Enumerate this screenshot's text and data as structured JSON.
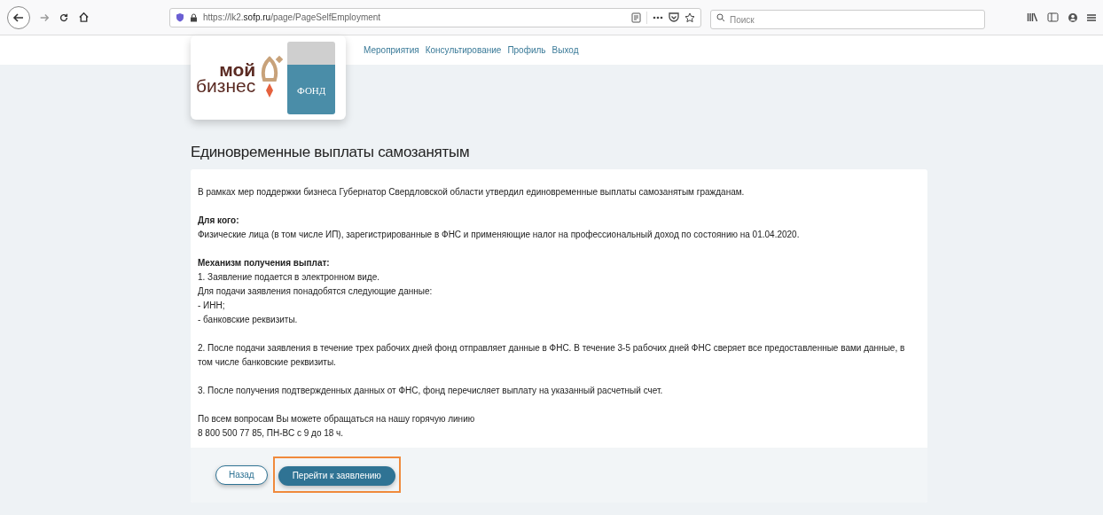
{
  "browser": {
    "url_prefix": "https://lk2.",
    "url_domain": "sofp.ru",
    "url_path": "/page/PageSelfEmployment",
    "search": {
      "placeholder": "Поиск"
    }
  },
  "logo": {
    "word_1": "мой",
    "word_2": "бизнес",
    "fund": "ФОНД"
  },
  "nav": [
    "Мероприятия",
    "Консультирование",
    "Профиль",
    "Выход"
  ],
  "title": "Единовременные выплаты самозанятым",
  "content": [
    {
      "kind": "text",
      "text": "В рамках мер поддержки бизнеса Губернатор Свердловской области утвердил единовременные выплаты самозанятым гражданам."
    },
    {
      "kind": "gap"
    },
    {
      "kind": "heading",
      "text": "Для кого:"
    },
    {
      "kind": "text",
      "text": "Физические лица (в том числе ИП), зарегистрированные в ФНС и применяющие налог на профессиональный доход по состоянию на 01.04.2020."
    },
    {
      "kind": "gap"
    },
    {
      "kind": "heading",
      "text": "Механизм получения выплат:"
    },
    {
      "kind": "text",
      "text": "1. Заявление подается в электронном виде."
    },
    {
      "kind": "text",
      "text": "Для подачи заявления понадобятся следующие данные:"
    },
    {
      "kind": "text",
      "text": "- ИНН;"
    },
    {
      "kind": "text",
      "text": "- банковские реквизиты."
    },
    {
      "kind": "gap"
    },
    {
      "kind": "text",
      "text": "2. После подачи заявления в течение трех рабочих дней фонд отправляет данные в ФНС. В течение 3-5 рабочих дней ФНС сверяет все предоставленные вами данные, в том числе банковские реквизиты."
    },
    {
      "kind": "gap"
    },
    {
      "kind": "text",
      "text": "3. После получения подтвержденных данных от ФНС, фонд перечисляет выплату на указанный расчетный счет."
    },
    {
      "kind": "gap"
    },
    {
      "kind": "text",
      "text": "По всем вопросам Вы можете обращаться на нашу горячую линию"
    },
    {
      "kind": "text",
      "text": "8 800 500 77 85, ПН-ВС с 9 до 18 ч."
    }
  ],
  "buttons": [
    {
      "label": "Назад",
      "kind": "secondary",
      "highlighted": false
    },
    {
      "label": "Перейти к заявлению",
      "kind": "primary",
      "highlighted": true
    }
  ]
}
